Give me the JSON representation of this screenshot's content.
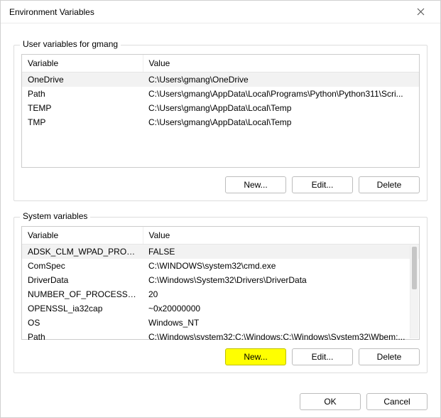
{
  "window": {
    "title": "Environment Variables"
  },
  "user": {
    "group_label": "User variables for gmang",
    "headers": {
      "variable": "Variable",
      "value": "Value"
    },
    "rows": [
      {
        "variable": "OneDrive",
        "value": "C:\\Users\\gmang\\OneDrive",
        "selected": true
      },
      {
        "variable": "Path",
        "value": "C:\\Users\\gmang\\AppData\\Local\\Programs\\Python\\Python311\\Scri...",
        "selected": false
      },
      {
        "variable": "TEMP",
        "value": "C:\\Users\\gmang\\AppData\\Local\\Temp",
        "selected": false
      },
      {
        "variable": "TMP",
        "value": "C:\\Users\\gmang\\AppData\\Local\\Temp",
        "selected": false
      }
    ],
    "buttons": {
      "new": "New...",
      "edit": "Edit...",
      "delete": "Delete"
    }
  },
  "system": {
    "group_label": "System variables",
    "headers": {
      "variable": "Variable",
      "value": "Value"
    },
    "rows": [
      {
        "variable": "ADSK_CLM_WPAD_PROXY_...",
        "value": "FALSE",
        "selected": true
      },
      {
        "variable": "ComSpec",
        "value": "C:\\WINDOWS\\system32\\cmd.exe",
        "selected": false
      },
      {
        "variable": "DriverData",
        "value": "C:\\Windows\\System32\\Drivers\\DriverData",
        "selected": false
      },
      {
        "variable": "NUMBER_OF_PROCESSORS",
        "value": "20",
        "selected": false
      },
      {
        "variable": "OPENSSL_ia32cap",
        "value": "~0x20000000",
        "selected": false
      },
      {
        "variable": "OS",
        "value": "Windows_NT",
        "selected": false
      },
      {
        "variable": "Path",
        "value": "C:\\Windows\\system32;C:\\Windows;C:\\Windows\\System32\\Wbem;...",
        "selected": false
      }
    ],
    "buttons": {
      "new": "New...",
      "edit": "Edit...",
      "delete": "Delete"
    }
  },
  "footer": {
    "ok": "OK",
    "cancel": "Cancel"
  },
  "highlights": {
    "system_new": true
  }
}
